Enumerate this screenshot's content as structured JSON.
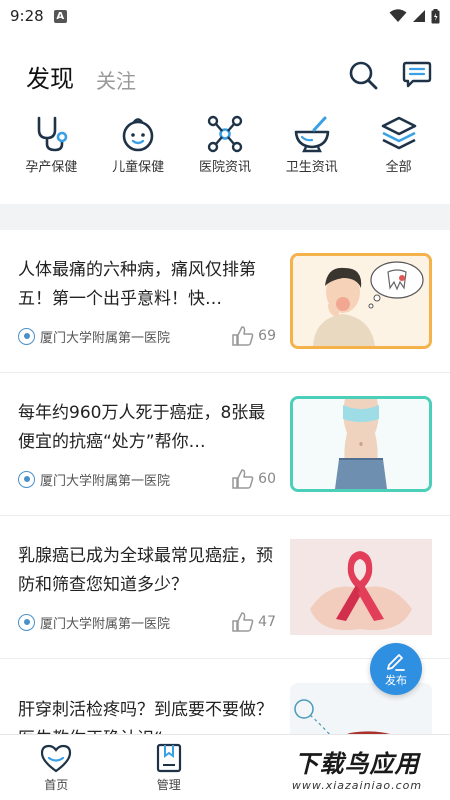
{
  "status": {
    "time": "9:28",
    "notif_letter": "A"
  },
  "header": {
    "tab_active": "发现",
    "tab_inactive": "关注"
  },
  "categories": [
    {
      "label": "孕产保健",
      "icon": "stethoscope-icon"
    },
    {
      "label": "儿童保健",
      "icon": "baby-icon"
    },
    {
      "label": "医院资讯",
      "icon": "molecule-icon"
    },
    {
      "label": "卫生资讯",
      "icon": "mortar-icon"
    },
    {
      "label": "全部",
      "icon": "layers-icon"
    }
  ],
  "feed": [
    {
      "title": "人体最痛的六种病，痛风仅排第五！第一个出乎意料！快…",
      "source": "厦门大学附属第一医院",
      "likes": "69",
      "thumb": "toothache-illustration",
      "border": "#f5b14a"
    },
    {
      "title": "每年约960万人死于癌症，8张最便宜的抗癌“处方”帮你…",
      "source": "厦门大学附属第一医院",
      "likes": "60",
      "thumb": "waist-measure-photo",
      "border": "#4ccfb8"
    },
    {
      "title": "乳腺癌已成为全球最常见癌症，预防和筛查您知道多少？",
      "source": "厦门大学附属第一医院",
      "likes": "47",
      "thumb": "pink-ribbon-photo",
      "border": ""
    },
    {
      "title": "肝穿刺活检疼吗？到底要不要做？医生教你正确认识“…",
      "source": "",
      "likes": "",
      "thumb": "liver-cell-illustration",
      "border": ""
    }
  ],
  "fab": {
    "label": "发布"
  },
  "nav": [
    {
      "label": "首页",
      "icon": "heart-home-icon"
    },
    {
      "label": "管理",
      "icon": "bookmark-book-icon"
    }
  ],
  "watermark": {
    "main": "下载鸟应用",
    "sub": "www.xiazainiao.com"
  },
  "colors": {
    "accent": "#2f8fe0",
    "icon_dark": "#1e3348",
    "icon_blue": "#3aa0e6"
  }
}
